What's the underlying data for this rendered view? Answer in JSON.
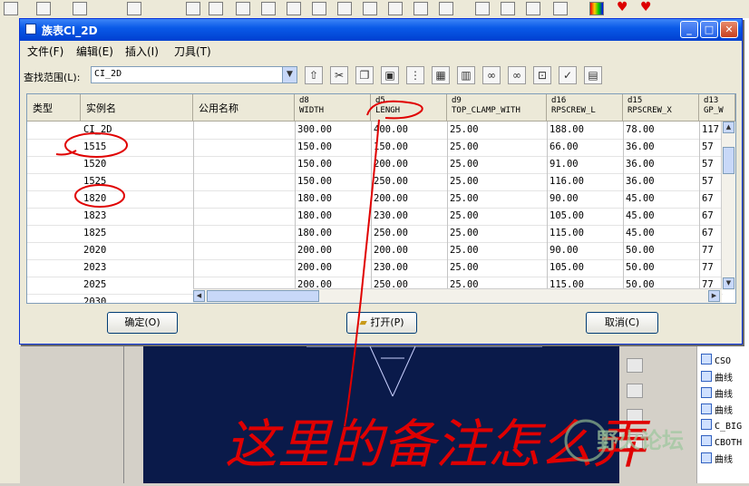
{
  "dialog": {
    "title": "族表CI_2D",
    "menu": [
      "文件(F)",
      "编辑(E)",
      "插入(I)",
      "刀具(T)"
    ],
    "find_label": "查找范围(L):",
    "find_value": "CI_2D",
    "buttons": {
      "ok": "确定(O)",
      "open": "打开(P)",
      "cancel": "取消(C)"
    }
  },
  "grid": {
    "name_headers": [
      "类型",
      "实例名",
      "公用名称"
    ],
    "param_headers": [
      {
        "code": "d8",
        "name": "WIDTH"
      },
      {
        "code": "d5",
        "name": "LENGH"
      },
      {
        "code": "d9",
        "name": "TOP_CLAMP_WITH"
      },
      {
        "code": "d16",
        "name": "RPSCREW_L"
      },
      {
        "code": "d15",
        "name": "RPSCREW_X"
      },
      {
        "code": "d13",
        "name": "GP_W"
      }
    ],
    "rows": [
      [
        "",
        "CI_2D",
        "",
        "300.00",
        "400.00",
        "25.00",
        "188.00",
        "78.00",
        "117.00"
      ],
      [
        "",
        "1515",
        "",
        "150.00",
        "150.00",
        "25.00",
        "66.00",
        "36.00",
        "57"
      ],
      [
        "",
        "1520",
        "",
        "150.00",
        "200.00",
        "25.00",
        "91.00",
        "36.00",
        "57"
      ],
      [
        "",
        "1525",
        "",
        "150.00",
        "250.00",
        "25.00",
        "116.00",
        "36.00",
        "57"
      ],
      [
        "",
        "1820",
        "",
        "180.00",
        "200.00",
        "25.00",
        "90.00",
        "45.00",
        "67"
      ],
      [
        "",
        "1823",
        "",
        "180.00",
        "230.00",
        "25.00",
        "105.00",
        "45.00",
        "67"
      ],
      [
        "",
        "1825",
        "",
        "180.00",
        "250.00",
        "25.00",
        "115.00",
        "45.00",
        "67"
      ],
      [
        "",
        "2020",
        "",
        "200.00",
        "200.00",
        "25.00",
        "90.00",
        "50.00",
        "77"
      ],
      [
        "",
        "2023",
        "",
        "200.00",
        "230.00",
        "25.00",
        "105.00",
        "50.00",
        "77"
      ],
      [
        "",
        "2025",
        "",
        "200.00",
        "250.00",
        "25.00",
        "115.00",
        "50.00",
        "77"
      ],
      [
        "",
        "2030",
        "",
        "",
        "",
        "",
        "",
        "",
        ""
      ]
    ]
  },
  "right_tree": [
    "CSO",
    "曲线",
    "曲线",
    "曲线",
    "C_BIG",
    "CBOTH",
    "曲线"
  ],
  "annotation_text": "这里的备注怎么弄",
  "watermark": "野火论坛",
  "colors": {
    "annotation": "#e00000",
    "title_blue": "#0a5ae8"
  }
}
